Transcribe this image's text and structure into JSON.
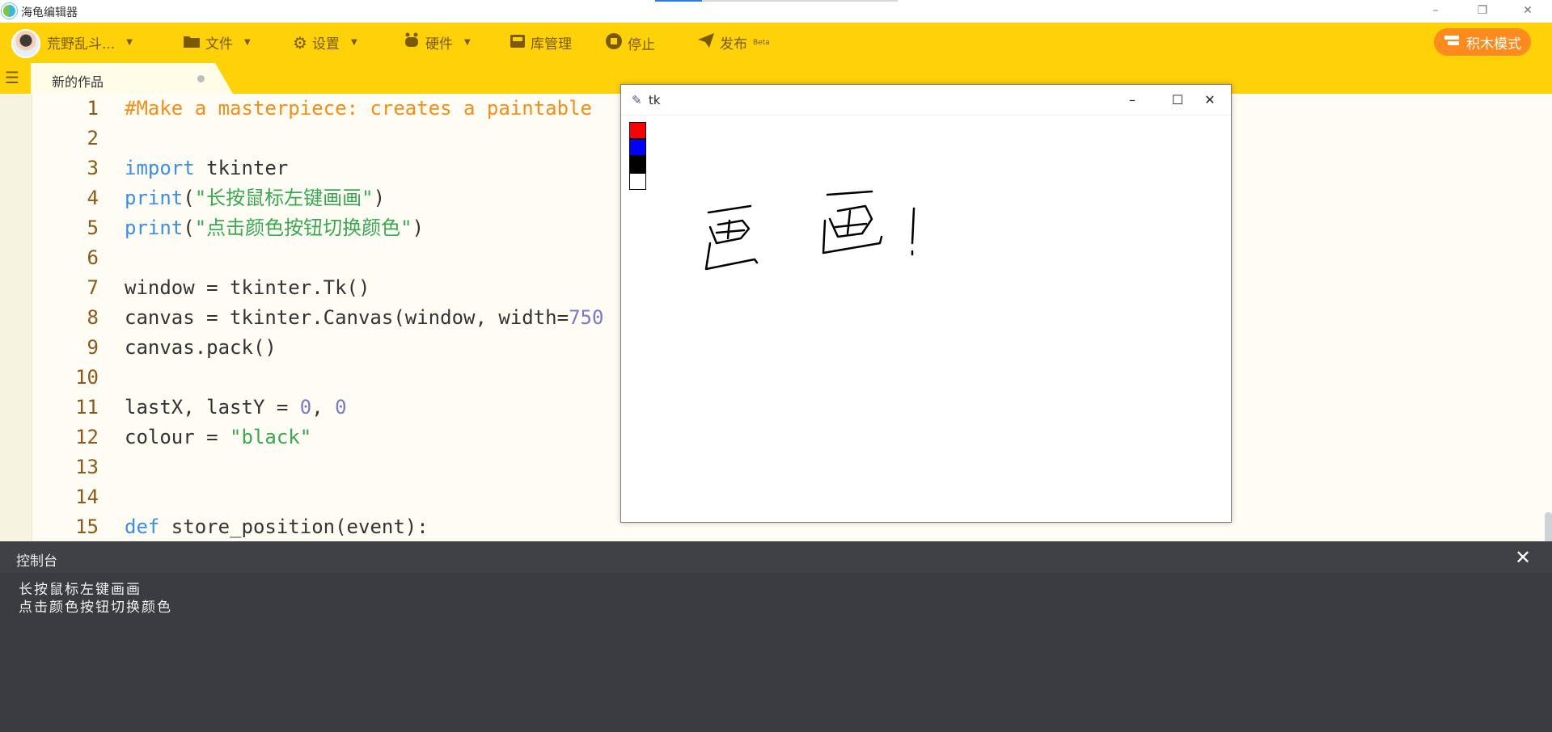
{
  "window": {
    "title": "海龟编辑器",
    "controls": {
      "minimize": "–",
      "restore": "❐",
      "close": "✕"
    }
  },
  "toolbar": {
    "user_name": "荒野乱斗...",
    "file_label": "文件",
    "settings_label": "设置",
    "hardware_label": "硬件",
    "library_label": "库管理",
    "stop_label": "停止",
    "publish_label": "发布",
    "publish_badge": "Beta",
    "block_mode_label": "积木模式"
  },
  "tabs": [
    {
      "label": "新的作品",
      "modified": true
    }
  ],
  "editor": {
    "lines": [
      {
        "number": "1",
        "segments": [
          {
            "type": "comment",
            "text": "#Make a masterpiece: creates a paintable"
          }
        ]
      },
      {
        "number": "2",
        "segments": []
      },
      {
        "number": "3",
        "segments": [
          {
            "type": "kw",
            "text": "import"
          },
          {
            "type": "plain",
            "text": " tkinter"
          }
        ]
      },
      {
        "number": "4",
        "segments": [
          {
            "type": "fn",
            "text": "print"
          },
          {
            "type": "plain",
            "text": "("
          },
          {
            "type": "str",
            "text": "\"长按鼠标左键画画\""
          },
          {
            "type": "plain",
            "text": ")"
          }
        ]
      },
      {
        "number": "5",
        "segments": [
          {
            "type": "fn",
            "text": "print"
          },
          {
            "type": "plain",
            "text": "("
          },
          {
            "type": "str",
            "text": "\"点击颜色按钮切换颜色\""
          },
          {
            "type": "plain",
            "text": ")"
          }
        ]
      },
      {
        "number": "6",
        "segments": []
      },
      {
        "number": "7",
        "segments": [
          {
            "type": "plain",
            "text": "window = tkinter.Tk()"
          }
        ]
      },
      {
        "number": "8",
        "segments": [
          {
            "type": "plain",
            "text": "canvas = tkinter.Canvas(window, width="
          },
          {
            "type": "num",
            "text": "750"
          }
        ]
      },
      {
        "number": "9",
        "segments": [
          {
            "type": "plain",
            "text": "canvas.pack()"
          }
        ]
      },
      {
        "number": "10",
        "segments": []
      },
      {
        "number": "11",
        "segments": [
          {
            "type": "plain",
            "text": "lastX, lastY = "
          },
          {
            "type": "num",
            "text": "0"
          },
          {
            "type": "plain",
            "text": ", "
          },
          {
            "type": "num",
            "text": "0"
          }
        ]
      },
      {
        "number": "12",
        "segments": [
          {
            "type": "plain",
            "text": "colour = "
          },
          {
            "type": "str",
            "text": "\"black\""
          }
        ]
      },
      {
        "number": "13",
        "segments": []
      },
      {
        "number": "14",
        "segments": []
      },
      {
        "number": "15",
        "segments": [
          {
            "type": "kw",
            "text": "def"
          },
          {
            "type": "plain",
            "text": " store_position(event):"
          }
        ]
      }
    ],
    "floating_stop_label": "停止"
  },
  "console": {
    "title": "控制台",
    "close_icon": "✕",
    "output": [
      "长按鼠标左键画画",
      "点击颜色按钮切换颜色"
    ]
  },
  "tk_window": {
    "title": "tk",
    "controls": {
      "minimize": "–",
      "maximize": "☐",
      "close": "✕"
    },
    "palette": [
      {
        "name": "red",
        "color": "#ff0000"
      },
      {
        "name": "blue",
        "color": "#0000ff"
      },
      {
        "name": "black",
        "color": "#000000"
      },
      {
        "name": "white",
        "color": "#ffffff"
      }
    ],
    "stroke_color": "#000000"
  },
  "colors": {
    "accent_yellow": "#fed109",
    "block_mode_orange": "#ff8b1f",
    "console_bg": "#3a3c41"
  }
}
